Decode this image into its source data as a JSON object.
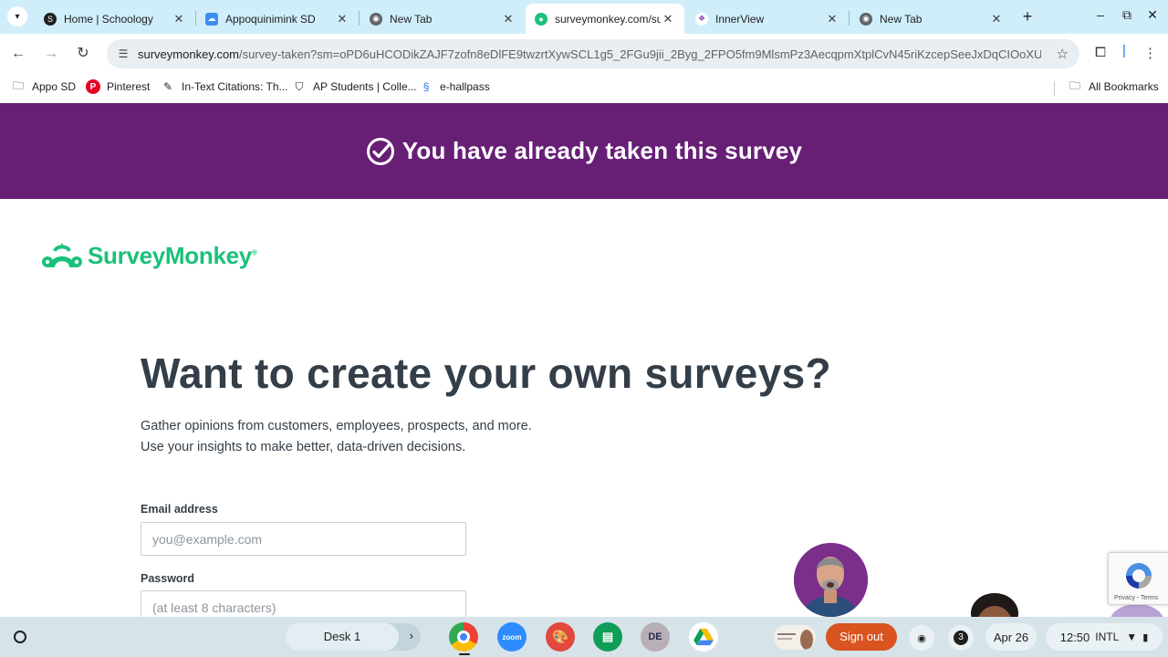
{
  "browser": {
    "tabs": [
      {
        "title": "Home | Schoology",
        "icon": "schoology-icon",
        "active": false
      },
      {
        "title": "Appoquinimink SD",
        "icon": "cloud-icon",
        "active": false
      },
      {
        "title": "New Tab",
        "icon": "chrome-icon",
        "active": false
      },
      {
        "title": "surveymonkey.com/su",
        "icon": "surveymonkey-icon",
        "active": true
      },
      {
        "title": "InnerView",
        "icon": "innerview-icon",
        "active": false
      },
      {
        "title": "New Tab",
        "icon": "chrome-icon",
        "active": false
      }
    ],
    "url_host": "surveymonkey.com",
    "url_path": "/survey-taken?sm=oPD6uHCODikZAJF7zofn8eDlFE9twzrtXywSCL1g5_2FGu9jii_2Byg_2FPO5fm9MlsmPz3AecqpmXtplCvN45riKzcepSeeJxDqCIOoXU...",
    "bookmarks": [
      {
        "label": "Appo SD",
        "icon": "folder-icon"
      },
      {
        "label": "Pinterest",
        "icon": "pinterest-icon"
      },
      {
        "label": "In-Text Citations: Th...",
        "icon": "citation-icon"
      },
      {
        "label": "AP Students | Colle...",
        "icon": "ap-icon"
      },
      {
        "label": "e-hallpass",
        "icon": "hallpass-icon"
      }
    ],
    "all_bookmarks": "All Bookmarks"
  },
  "page": {
    "banner_text": "You have already taken this survey",
    "logo_text": "SurveyMonkey",
    "logo_reg": "®",
    "headline": "Want to create your own surveys?",
    "subtext_line1": "Gather opinions from customers, employees, prospects, and more.",
    "subtext_line2": "Use your insights to make better, data-driven decisions.",
    "email_label": "Email address",
    "email_placeholder": "you@example.com",
    "password_label": "Password",
    "password_placeholder": "(at least 8 characters)",
    "recaptcha_text": "Privacy - Terms"
  },
  "shelf": {
    "desk_label": "Desk 1",
    "apps": [
      "chrome",
      "zoom",
      "canvas-paint",
      "google-classroom",
      "disney-plus",
      "google-drive"
    ],
    "zoom_label": "zoom",
    "signout_label": "Sign out",
    "notification_count": "3",
    "date": "Apr 26",
    "time": "12:50",
    "ime": "INTL"
  },
  "colors": {
    "banner": "#671e75",
    "brand_green": "#1ac17a",
    "signout": "#d9541e",
    "tabstrip": "#cfeefa"
  }
}
